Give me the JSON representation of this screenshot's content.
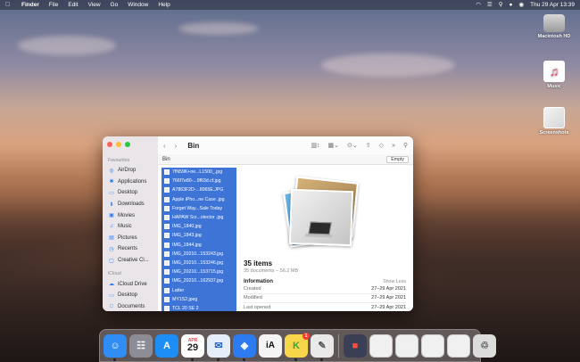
{
  "menubar": {
    "app_name": "Finder",
    "menus": [
      "File",
      "Edit",
      "View",
      "Go",
      "Window",
      "Help"
    ],
    "clock": "Thu 29 Apr  13:39"
  },
  "desktop_icons": [
    {
      "label": "Macintosh HD",
      "icon": "hard-drive-icon"
    },
    {
      "label": "Music",
      "icon": "music-note-icon"
    },
    {
      "label": "Screenshots",
      "icon": "folder-icon"
    }
  ],
  "finder": {
    "title": "Bin",
    "path": "Bin",
    "empty_button": "Empty",
    "sidebar": {
      "favourites_header": "Favourites",
      "favourites": [
        {
          "label": "AirDrop",
          "icon": "airdrop-icon"
        },
        {
          "label": "Applications",
          "icon": "applications-icon"
        },
        {
          "label": "Desktop",
          "icon": "desktop-icon"
        },
        {
          "label": "Downloads",
          "icon": "downloads-icon"
        },
        {
          "label": "Movies",
          "icon": "movies-icon"
        },
        {
          "label": "Music",
          "icon": "music-icon"
        },
        {
          "label": "Pictures",
          "icon": "pictures-icon"
        },
        {
          "label": "Recents",
          "icon": "recents-icon"
        },
        {
          "label": "Creative Cl...",
          "icon": "folder-icon"
        }
      ],
      "icloud_header": "iCloud",
      "icloud": [
        {
          "label": "iCloud Drive",
          "icon": "cloud-icon"
        },
        {
          "label": "Desktop",
          "icon": "desktop-icon"
        },
        {
          "label": "Documents",
          "icon": "document-icon"
        }
      ]
    },
    "files": [
      "7fN59K+ne...L1500_.jpg",
      "766f7e80-...9f63d.cf.jpg",
      "A7863F2D-...8965E.JPG",
      "Apple iPho...ne Case .jpg",
      "Forget Way...Sale Today",
      "HAPAW Scr...otector .jpg",
      "IMG_1840.jpg",
      "IMG_1843.jpg",
      "IMG_1844.jpg",
      "IMG_20210...153243.jpg",
      "IMG_20210...153246.jpg",
      "IMG_20210...153715.jpg",
      "IMG_20210...162937.jpg",
      "Latter",
      "MY1S2.jpeg",
      "TCL 20 SE 2"
    ],
    "preview": {
      "items_count": "35 items",
      "items_sub": "35 documents – 56.2 MB",
      "info_header": "Information",
      "show_less": "Show Less",
      "rows": [
        {
          "label": "Created",
          "value": "27–29 Apr 2021"
        },
        {
          "label": "Modified",
          "value": "27–29 Apr 2021"
        },
        {
          "label": "Last opened",
          "value": "27–29 Apr 2021"
        }
      ]
    }
  },
  "dock": {
    "apps": [
      {
        "name": "finder-icon",
        "color": "#2f8df3"
      },
      {
        "name": "launchpad-icon",
        "color": "#8c8c96"
      },
      {
        "name": "app-store-icon",
        "color": "#1d8ef5"
      },
      {
        "name": "calendar-icon",
        "color": "#ffffff",
        "month": "APR",
        "day": "29"
      },
      {
        "name": "mail-icon",
        "color": "#e5edf8"
      },
      {
        "name": "safari-icon",
        "color": "#2d7bf0"
      },
      {
        "name": "ia-writer-icon",
        "color": "#f4f4f4",
        "text": "iA"
      },
      {
        "name": "notes-icon",
        "color": "#f7d64a",
        "badge": "1"
      },
      {
        "name": "pencil-app-icon",
        "color": "#e9e9e9"
      }
    ],
    "right_items": [
      {
        "name": "screenshot-app-icon",
        "color": "#3a3f55"
      },
      {
        "name": "screenshot-thumbnail-icon",
        "color": "#f0f0f0"
      },
      {
        "name": "screenshot-thumbnail-icon",
        "color": "#f0f0f0"
      },
      {
        "name": "screenshot-thumbnail-icon",
        "color": "#f0f0f0"
      },
      {
        "name": "screenshot-thumbnail-icon",
        "color": "#f0f0f0"
      },
      {
        "name": "bin-full-icon",
        "color": "#dcdcdc"
      }
    ]
  }
}
